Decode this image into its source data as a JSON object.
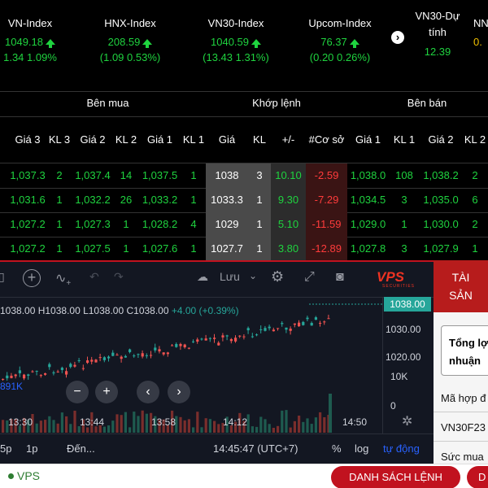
{
  "indices": [
    {
      "name": "VN-Index",
      "value": "1049.18",
      "change": "1.34 1.09%"
    },
    {
      "name": "HNX-Index",
      "value": "208.59",
      "change": "(1.09 0.53%)"
    },
    {
      "name": "VN30-Index",
      "value": "1040.59",
      "change": "(13.43 1.31%)"
    },
    {
      "name": "Upcom-Index",
      "value": "76.37",
      "change": "(0.20 0.26%)"
    },
    {
      "name": "VN30-Dự tính",
      "value": "12.39"
    },
    {
      "name": "NN",
      "value": "0."
    }
  ],
  "book": {
    "group_buy": "Bên mua",
    "group_match": "Khớp lệnh",
    "group_sell": "Bên bán",
    "headers": [
      "Giá 3",
      "KL 3",
      "Giá 2",
      "KL 2",
      "Giá 1",
      "KL 1",
      "Giá",
      "KL",
      "+/-",
      "#Cơ sở",
      "Giá 1",
      "KL 1",
      "Giá 2",
      "KL 2"
    ],
    "rows": [
      [
        "1,037.3",
        "2",
        "1,037.4",
        "14",
        "1,037.5",
        "1",
        "1038",
        "3",
        "10.10",
        "-2.59",
        "1,038.0",
        "108",
        "1,038.2",
        "2"
      ],
      [
        "1,031.6",
        "1",
        "1,032.2",
        "26",
        "1,033.2",
        "1",
        "1033.3",
        "1",
        "9.30",
        "-7.29",
        "1,034.5",
        "3",
        "1,035.0",
        "6"
      ],
      [
        "1,027.2",
        "1",
        "1,027.3",
        "1",
        "1,028.2",
        "4",
        "1029",
        "1",
        "5.10",
        "-11.59",
        "1,029.0",
        "1",
        "1,030.0",
        "2"
      ],
      [
        "1,027.2",
        "1",
        "1,027.5",
        "1",
        "1,027.6",
        "1",
        "1027.7",
        "1",
        "3.80",
        "-12.89",
        "1,027.8",
        "3",
        "1,027.9",
        "1"
      ]
    ]
  },
  "chart": {
    "save_label": "Lưu",
    "logo": "VPS",
    "logo_sub": "SECURITIES",
    "ohlc_text": "1038.00 H1038.00 L1038.00 C1038.00",
    "ohlc_change": "+4.00 (+0.39%)",
    "last_price": "1038.00",
    "y_labels": [
      "1030.00",
      "1020.00"
    ],
    "vol_axis": [
      "10K",
      "0"
    ],
    "volume_label": "891K",
    "x_labels": [
      "13:30",
      "13:44",
      "13:58",
      "14:12",
      "14:50"
    ],
    "periods": [
      "5p",
      "1p"
    ],
    "goto": "Đến...",
    "clock": "14:45:47 (UTC+7)",
    "pct": "%",
    "log": "log",
    "auto": "tự động",
    "colors": {
      "up": "#26a69a",
      "down": "#ef5350",
      "bg": "#131722"
    }
  },
  "panel": {
    "tab": "TÀI SẢN",
    "total_line1": "Tổng lợ",
    "total_line2": "nhuận",
    "contract": "Mã hợp đ",
    "contract_value": "VN30F23",
    "power": "Sức mua"
  },
  "footer": {
    "brand": "VPS",
    "orders_button": "DANH SÁCH LỆNH",
    "extra_button": "D"
  }
}
